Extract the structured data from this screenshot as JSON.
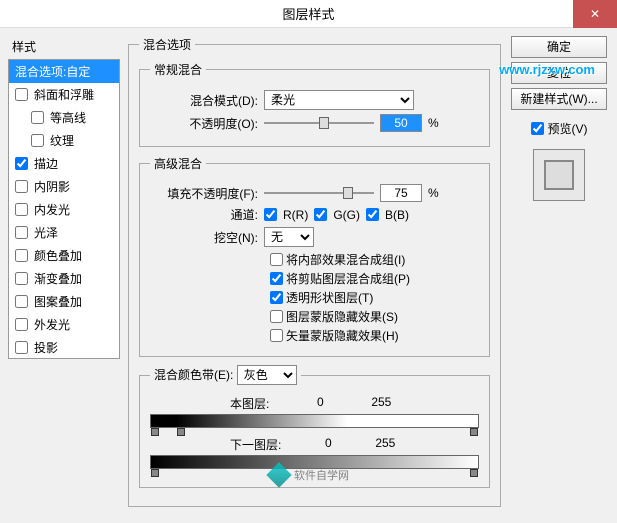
{
  "title": "图层样式",
  "styles_label": "样式",
  "styles": [
    {
      "label": "混合选项:自定",
      "checked": null,
      "selected": true,
      "sub": false
    },
    {
      "label": "斜面和浮雕",
      "checked": false,
      "sub": false
    },
    {
      "label": "等高线",
      "checked": false,
      "sub": true
    },
    {
      "label": "纹理",
      "checked": false,
      "sub": true
    },
    {
      "label": "描边",
      "checked": true,
      "sub": false
    },
    {
      "label": "内阴影",
      "checked": false,
      "sub": false
    },
    {
      "label": "内发光",
      "checked": false,
      "sub": false
    },
    {
      "label": "光泽",
      "checked": false,
      "sub": false
    },
    {
      "label": "颜色叠加",
      "checked": false,
      "sub": false
    },
    {
      "label": "渐变叠加",
      "checked": false,
      "sub": false
    },
    {
      "label": "图案叠加",
      "checked": false,
      "sub": false
    },
    {
      "label": "外发光",
      "checked": false,
      "sub": false
    },
    {
      "label": "投影",
      "checked": false,
      "sub": false
    }
  ],
  "blend_options": {
    "legend": "混合选项",
    "normal": {
      "legend": "常规混合",
      "mode_label": "混合模式(D):",
      "mode_value": "柔光",
      "opacity_label": "不透明度(O):",
      "opacity_value": "50",
      "pct": "%"
    },
    "advanced": {
      "legend": "高级混合",
      "fill_label": "填充不透明度(F):",
      "fill_value": "75",
      "pct": "%",
      "channel_label": "通道:",
      "ch_r": "R(R)",
      "ch_g": "G(G)",
      "ch_b": "B(B)",
      "knockout_label": "挖空(N):",
      "knockout_value": "无",
      "opts": [
        {
          "checked": false,
          "label": "将内部效果混合成组(I)"
        },
        {
          "checked": true,
          "label": "将剪贴图层混合成组(P)"
        },
        {
          "checked": true,
          "label": "透明形状图层(T)"
        },
        {
          "checked": false,
          "label": "图层蒙版隐藏效果(S)"
        },
        {
          "checked": false,
          "label": "矢量蒙版隐藏效果(H)"
        }
      ]
    },
    "blendif": {
      "legend_label": "混合颜色带(E):",
      "legend_value": "灰色",
      "this_layer": "本图层:",
      "next_layer": "下一图层:",
      "v0": "0",
      "v255": "255"
    }
  },
  "buttons": {
    "ok": "确定",
    "cancel": "复位",
    "newstyle": "新建样式(W)...",
    "preview": "预览(V)"
  },
  "watermark": "www.rjzxw.com",
  "footer": "软件自学网"
}
